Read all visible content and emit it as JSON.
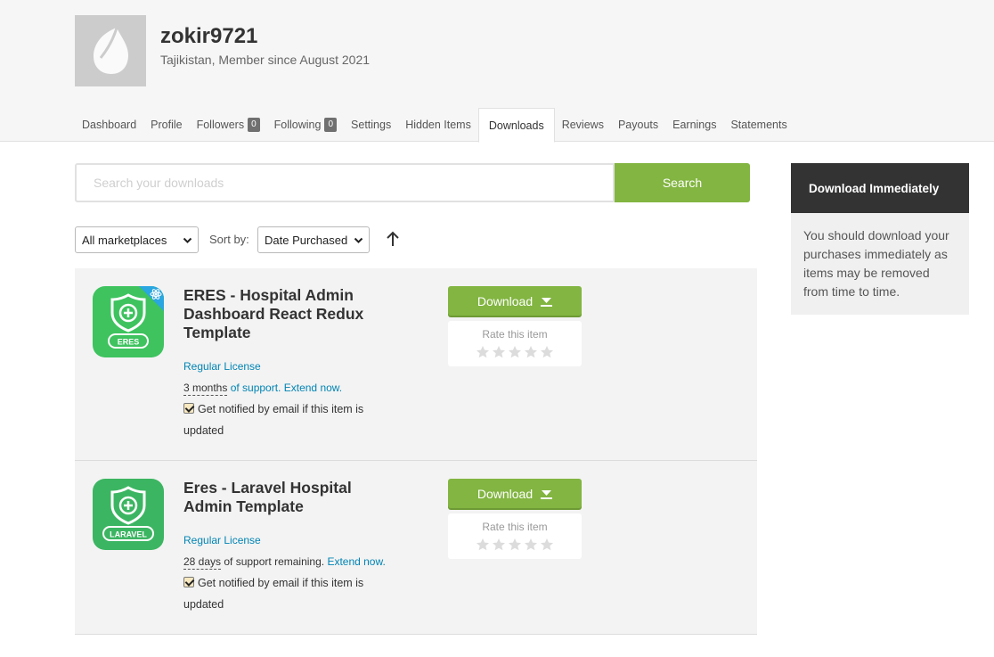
{
  "profile": {
    "username": "zokir9721",
    "meta": "Tajikistan, Member since August 2021"
  },
  "tabs": [
    {
      "label": "Dashboard"
    },
    {
      "label": "Profile"
    },
    {
      "label": "Followers",
      "count": "0"
    },
    {
      "label": "Following",
      "count": "0"
    },
    {
      "label": "Settings"
    },
    {
      "label": "Hidden Items"
    },
    {
      "label": "Downloads",
      "active": true
    },
    {
      "label": "Reviews"
    },
    {
      "label": "Payouts"
    },
    {
      "label": "Earnings"
    },
    {
      "label": "Statements"
    }
  ],
  "search": {
    "placeholder": "Search your downloads",
    "value": "",
    "button_label": "Search"
  },
  "filters": {
    "marketplace_selected": "All marketplaces",
    "sort_label": "Sort by:",
    "sort_selected": "Date Purchased",
    "sort_direction_icon": "arrow-up-icon"
  },
  "items": [
    {
      "title": "ERES - Hospital Admin Dashboard React Redux Template",
      "thumb_label": "ERES",
      "thumb_color": "#3ec35f",
      "license": "Regular License",
      "support_duration": "3 months",
      "support_text": " of support.",
      "support_link": "Extend now.",
      "notify_text": "Get notified by email if this item is updated",
      "notify_checked": true,
      "download_label": "Download",
      "rate_label": "Rate this item"
    },
    {
      "title": "Eres - Laravel Hospital Admin Template",
      "thumb_label": "LARAVEL",
      "thumb_color": "#3cb562",
      "license": "Regular License",
      "support_duration": "28 days",
      "support_text": " of support remaining.",
      "support_link": "Extend now.",
      "notify_text": "Get notified by email if this item is updated",
      "notify_checked": true,
      "download_label": "Download",
      "rate_label": "Rate this item"
    }
  ],
  "sidebar": {
    "title": "Download Immediately",
    "body": "You should download your purchases immediately as items may be removed from time to time."
  },
  "colors": {
    "accent_green": "#82b541",
    "link_blue": "#0084b4",
    "sidebar_dark": "#333333"
  }
}
